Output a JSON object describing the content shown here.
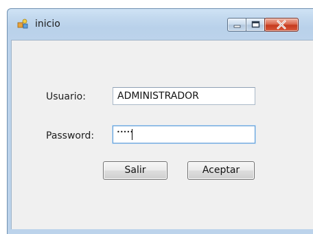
{
  "window": {
    "title": "inicio",
    "icon": "app-form-icon"
  },
  "title_buttons": {
    "minimize_icon": "minimize-icon",
    "maximize_icon": "maximize-icon",
    "close_icon": "close-icon"
  },
  "form": {
    "user_label": "Usuario:",
    "user_value": "ADMINISTRADOR",
    "password_label": "Password:",
    "password_masked": "•••••"
  },
  "buttons": {
    "exit_label": "Salir",
    "accept_label": "Aceptar"
  },
  "colors": {
    "title_gradient_top": "#cfe3f5",
    "client_bg": "#f0f0f0",
    "close_red": "#c53a1e",
    "focus_border": "#5e9bd6"
  }
}
